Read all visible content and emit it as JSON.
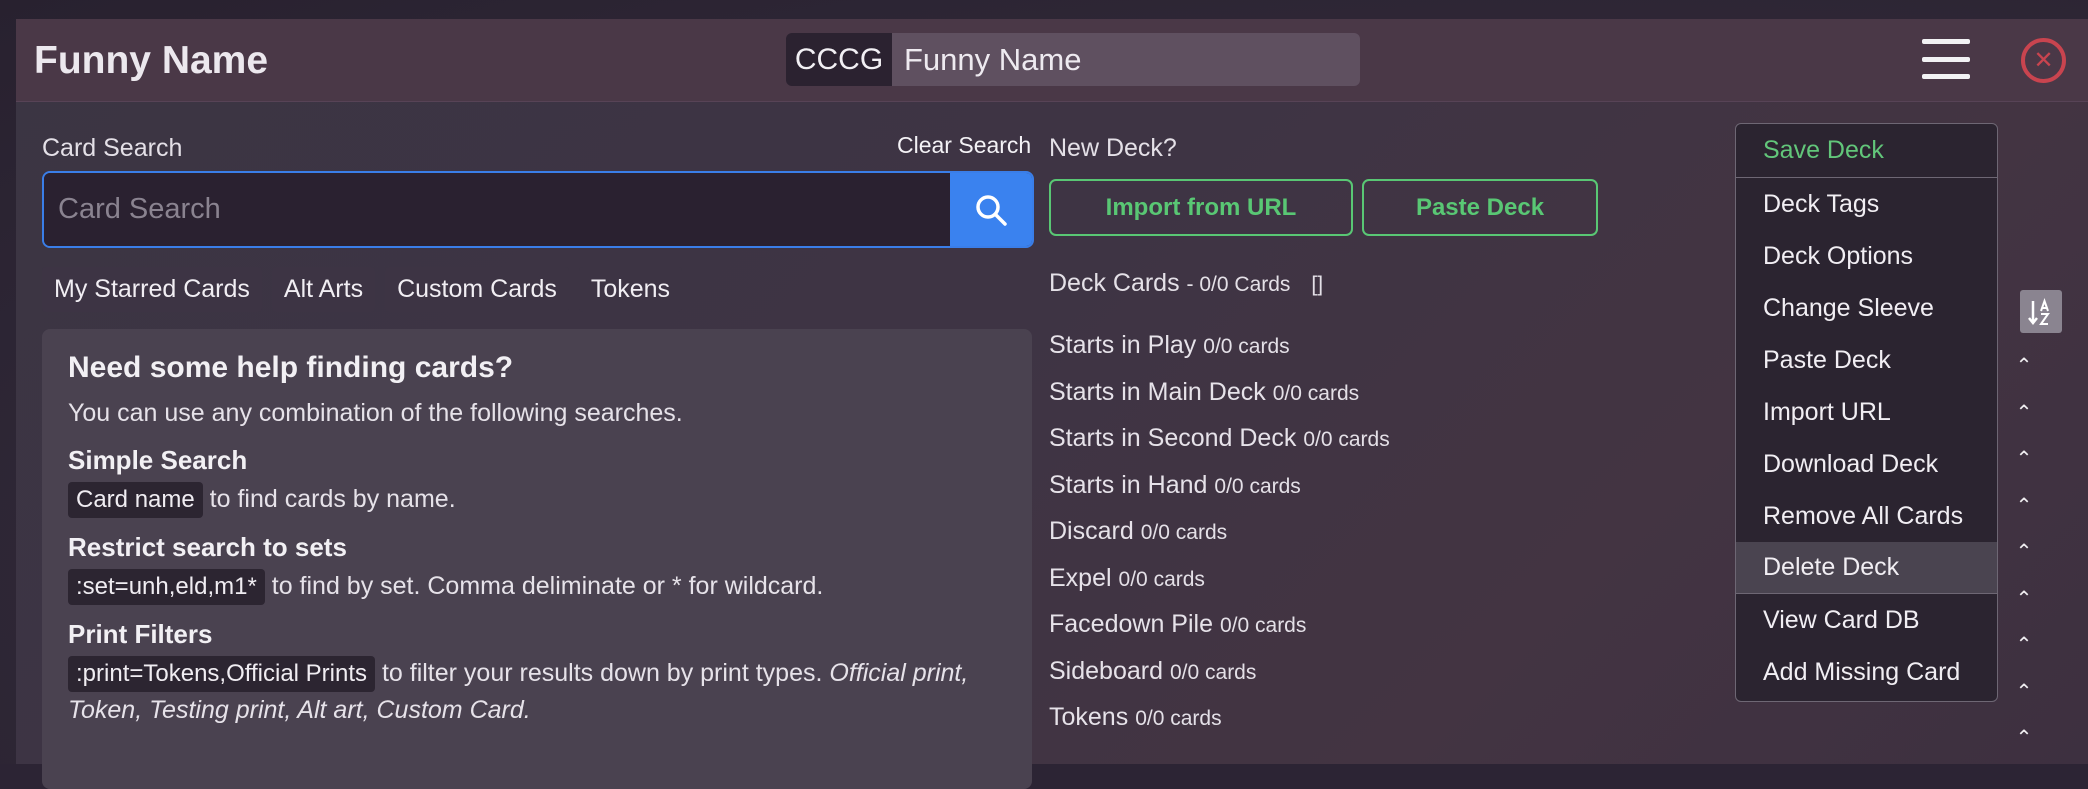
{
  "header": {
    "title": "Funny Name",
    "name_prefix": "CCCG",
    "name_value": "Funny Name"
  },
  "search": {
    "label": "Card Search",
    "placeholder": "Card Search",
    "clear_label": "Clear Search",
    "filters": [
      "My Starred Cards",
      "Alt Arts",
      "Custom Cards",
      "Tokens"
    ]
  },
  "help": {
    "title": "Need some help finding cards?",
    "intro": "You can use any combination of the following searches.",
    "sections": [
      {
        "heading": "Simple Search",
        "code": "Card name",
        "text": " to find cards by name."
      },
      {
        "heading": "Restrict search to sets",
        "code": ":set=unh,eld,m1*",
        "text": " to find by set. Comma deliminate or * for wildcard."
      },
      {
        "heading": "Print Filters",
        "code": ":print=Tokens,Official Prints",
        "text": " to filter your results down by print types. ",
        "italic": "Official print, Token, Testing print, Alt art, Custom Card."
      }
    ]
  },
  "new_deck": {
    "label": "New Deck?",
    "import_label": "Import from URL",
    "paste_label": "Paste Deck"
  },
  "deck": {
    "head_label": "Deck Cards",
    "head_count": "- 0/0 Cards",
    "head_tags": "[]",
    "zones": [
      {
        "name": "Starts in Play",
        "count": "0/0 cards"
      },
      {
        "name": "Starts in Main Deck",
        "count": "0/0 cards"
      },
      {
        "name": "Starts in Second Deck",
        "count": "0/0 cards"
      },
      {
        "name": "Starts in Hand",
        "count": "0/0 cards"
      },
      {
        "name": "Discard",
        "count": "0/0 cards"
      },
      {
        "name": "Expel",
        "count": "0/0 cards"
      },
      {
        "name": "Facedown Pile",
        "count": "0/0 cards"
      },
      {
        "name": "Sideboard",
        "count": "0/0 cards"
      },
      {
        "name": "Tokens",
        "count": "0/0 cards"
      }
    ]
  },
  "menu": {
    "items": [
      "Save Deck",
      "Deck Tags",
      "Deck Options",
      "Change Sleeve",
      "Paste Deck",
      "Import URL",
      "Download Deck",
      "Remove All Cards",
      "Delete Deck",
      "View Card DB",
      "Add Missing Card"
    ]
  },
  "colors": {
    "accent_blue": "#3a82ef",
    "accent_green": "#59c774",
    "close_red": "#c9444f"
  }
}
